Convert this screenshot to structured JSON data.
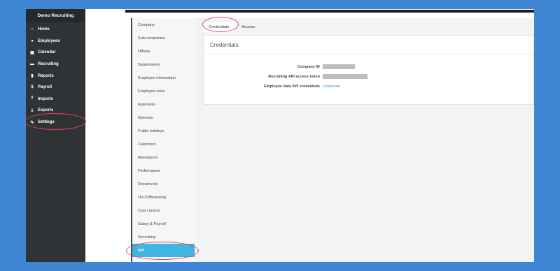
{
  "app": {
    "title": "Demo Recruiting"
  },
  "nav": {
    "items": [
      {
        "label": "Home",
        "icon": "home-icon",
        "glyph": "⌂"
      },
      {
        "label": "Employees",
        "icon": "employees-icon",
        "glyph": "●"
      },
      {
        "label": "Calendar",
        "icon": "calendar-icon",
        "glyph": "▦"
      },
      {
        "label": "Recruiting",
        "icon": "recruiting-icon",
        "glyph": "▬"
      },
      {
        "label": "Reports",
        "icon": "reports-icon",
        "glyph": "▮"
      },
      {
        "label": "Payroll",
        "icon": "payroll-icon",
        "glyph": "$"
      },
      {
        "label": "Imports",
        "icon": "imports-icon",
        "glyph": "⤒"
      },
      {
        "label": "Exports",
        "icon": "exports-icon",
        "glyph": "⤓"
      },
      {
        "label": "Settings",
        "icon": "wrench-icon",
        "glyph": "✎"
      }
    ]
  },
  "submenu": {
    "items": [
      "Company",
      "Sub-companies",
      "Offices",
      "Departments",
      "Employee information",
      "Employee roles",
      "Approvals",
      "Absence",
      "Public holidays",
      "Calendars",
      "Attendance",
      "Performance",
      "Documents",
      "On-/Offboarding",
      "Cost centers",
      "Salary & Payroll",
      "Recruiting",
      "API"
    ],
    "active": "API"
  },
  "tabs": [
    {
      "label": "Credentials",
      "active": true
    },
    {
      "label": "Access",
      "active": false
    }
  ],
  "panel": {
    "title": "Credentials",
    "rows": [
      {
        "label": "Company ID",
        "masked": true
      },
      {
        "label": "Recruiting API access token",
        "masked": true
      },
      {
        "label": "Employee data API credentials",
        "link": "Download"
      }
    ]
  },
  "colors": {
    "background": "#3f87d4",
    "nav": "#2f3336",
    "active_item": "#3eb6e0",
    "highlight": "#e2445c",
    "link": "#3a8fd6"
  }
}
